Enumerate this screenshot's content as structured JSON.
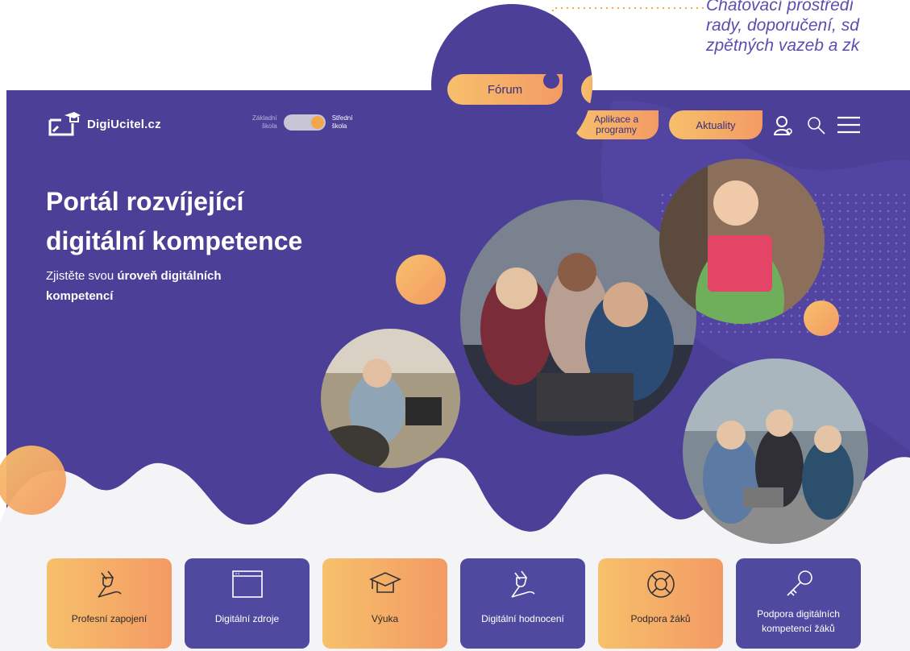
{
  "callout": {
    "lines": [
      "Chatovací prostředí",
      "rady, doporučení, sd",
      "zpětných vazeb a zk"
    ]
  },
  "header": {
    "logo_text": "DigiUcitel.cz",
    "toggle": {
      "left_label_line1": "Základní",
      "left_label_line2": "škola",
      "right_label_line1": "Střední",
      "right_label_line2": "škola"
    },
    "nav": {
      "forum": "Fórum",
      "aplikace_line1": "Aplikace a",
      "aplikace_line2": "programy",
      "aktuality": "Aktuality"
    },
    "icons": [
      "user-icon",
      "search-icon",
      "menu-icon"
    ]
  },
  "hero": {
    "title_line1": "Portál rozvíjející",
    "title_line2": "digitální kompetence",
    "subtitle_prefix": "Zjistěte svou ",
    "subtitle_bold1": "úroveň digitálních",
    "subtitle_bold2": "kompetencí"
  },
  "colors": {
    "hero_bg": "#4b3f98",
    "accent_orange": "#f39a64",
    "accent_yellow": "#f7c06b",
    "card_purple": "#4f4a9f"
  },
  "cards": [
    {
      "label": "Profesní zapojení",
      "icon": "plug-icon",
      "style": "orange"
    },
    {
      "label": "Digitální zdroje",
      "icon": "browser-window-icon",
      "style": "purple"
    },
    {
      "label": "Výuka",
      "icon": "graduation-cap-icon",
      "style": "orange"
    },
    {
      "label": "Digitální hodnocení",
      "icon": "plug-icon",
      "style": "purple"
    },
    {
      "label": "Podpora žáků",
      "icon": "lifebuoy-icon",
      "style": "orange"
    },
    {
      "label": "Podpora digitálních kompetencí žáků",
      "icon": "key-icon",
      "style": "purple"
    }
  ]
}
